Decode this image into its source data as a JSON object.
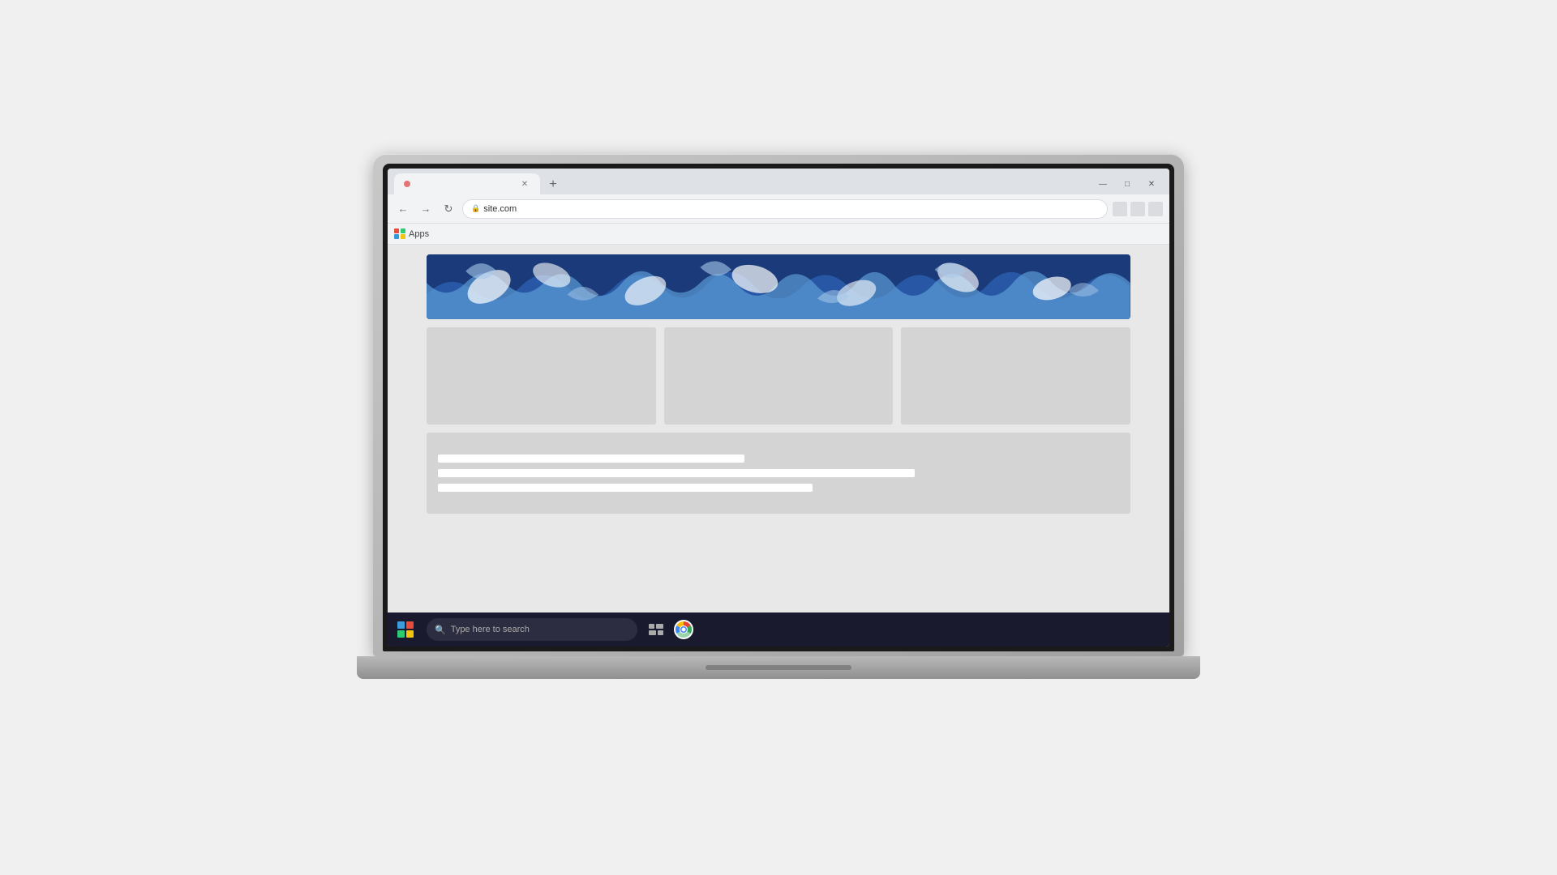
{
  "browser": {
    "tab_label": "",
    "address": "site.com",
    "bookmarks_label": "Apps",
    "window_minimize": "—",
    "window_maximize": "□",
    "window_close": "✕"
  },
  "taskbar": {
    "search_placeholder": "Type here to search"
  },
  "content": {
    "cards": [
      "",
      "",
      ""
    ],
    "content_lines": [
      {
        "width": "45%"
      },
      {
        "width": "70%"
      },
      {
        "width": "55%"
      }
    ]
  },
  "colors": {
    "hero_dark_blue": "#1a3a7a",
    "hero_mid_blue": "#2a5caa",
    "hero_light_blue": "#5b9bd5",
    "hero_pale_blue": "#a8c8e8",
    "taskbar_bg": "#1a1a2e",
    "card_bg": "#d4d4d4"
  },
  "icons": {
    "win_red": "#e74c3c",
    "win_green": "#2ecc71",
    "win_blue": "#3498db",
    "win_yellow": "#f1c40f"
  }
}
